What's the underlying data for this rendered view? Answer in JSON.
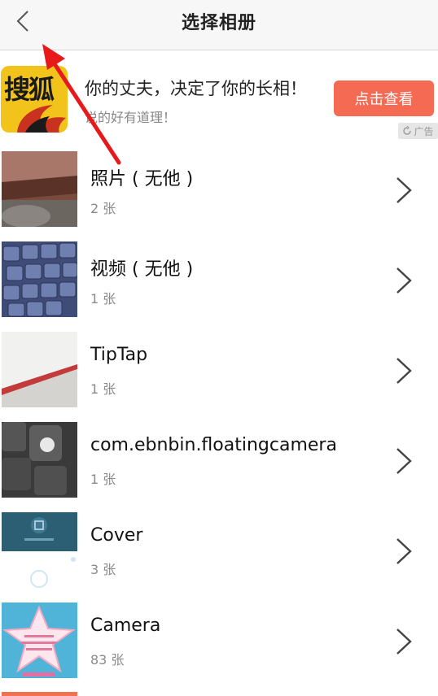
{
  "header": {
    "title": "选择相册",
    "back_icon": "chevron-left-icon"
  },
  "ad": {
    "logo_text": "搜狐",
    "title": "你的丈夫，决定了你的长相！",
    "subtitle": "说的好有道理！",
    "cta_label": "点击查看",
    "badge_label": "广告",
    "cta_color": "#f46a53"
  },
  "albums": [
    {
      "name": "照片 ( 无他 )",
      "count": "2 张"
    },
    {
      "name": "视频 ( 无他 )",
      "count": "1 张"
    },
    {
      "name": "TipTap",
      "count": "1 张"
    },
    {
      "name": "com.ebnbin.floatingcamera",
      "count": "1 张"
    },
    {
      "name": "Cover",
      "count": "3 张"
    },
    {
      "name": "Camera",
      "count": "83 张"
    }
  ],
  "annotation": {
    "color": "#e8191b",
    "icon": "red-arrow-icon"
  }
}
